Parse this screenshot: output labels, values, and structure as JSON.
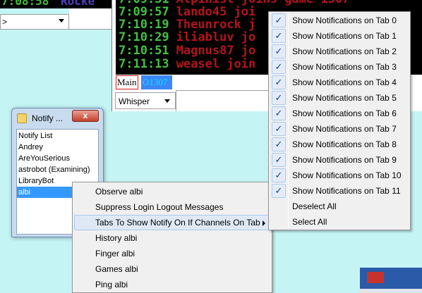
{
  "top_left": {
    "time": "7:08:58",
    "name": "Rocke",
    "dropdown_value": ">"
  },
  "chat": {
    "lines": [
      {
        "time": "7:09:57",
        "text": "lando45 joi"
      },
      {
        "time": "7:10:19",
        "text": "Theunrock j"
      },
      {
        "time": "7:10:29",
        "text": "iliabluv jo"
      },
      {
        "time": "7:10:51",
        "text": "Magnus87 jo"
      },
      {
        "time": "7:11:13",
        "text": "weasel join"
      }
    ],
    "tabs": [
      "Main",
      "O1307"
    ],
    "whisper_label": "Whisper"
  },
  "notify_window": {
    "title": "Notify ...",
    "close": "x",
    "items": [
      "Notify List",
      "Andrey",
      "AreYouSerious",
      "astrobot (Examining)",
      "LibraryBot",
      "albi"
    ],
    "selected_index": 5
  },
  "context_menu": {
    "items": [
      "Observe albi",
      "Suppress Login Logout Messages",
      "Tabs To Show Notify On If Channels On Tab",
      "History albi",
      "Finger albi",
      "Games albi",
      "Ping albi"
    ],
    "highlighted_index": 2
  },
  "submenu": {
    "checked_items": [
      "Show Notifications on Tab 0",
      "Show Notifications on Tab 1",
      "Show Notifications on Tab 2",
      "Show Notifications on Tab 3",
      "Show Notifications on Tab 4",
      "Show Notifications on Tab 5",
      "Show Notifications on Tab 6",
      "Show Notifications on Tab 7",
      "Show Notifications on Tab 8",
      "Show Notifications on Tab 9",
      "Show Notifications on Tab 10",
      "Show Notifications on Tab 11"
    ],
    "deselect_all": "Deselect All",
    "select_all": "Select All",
    "check_glyph": "✓"
  }
}
